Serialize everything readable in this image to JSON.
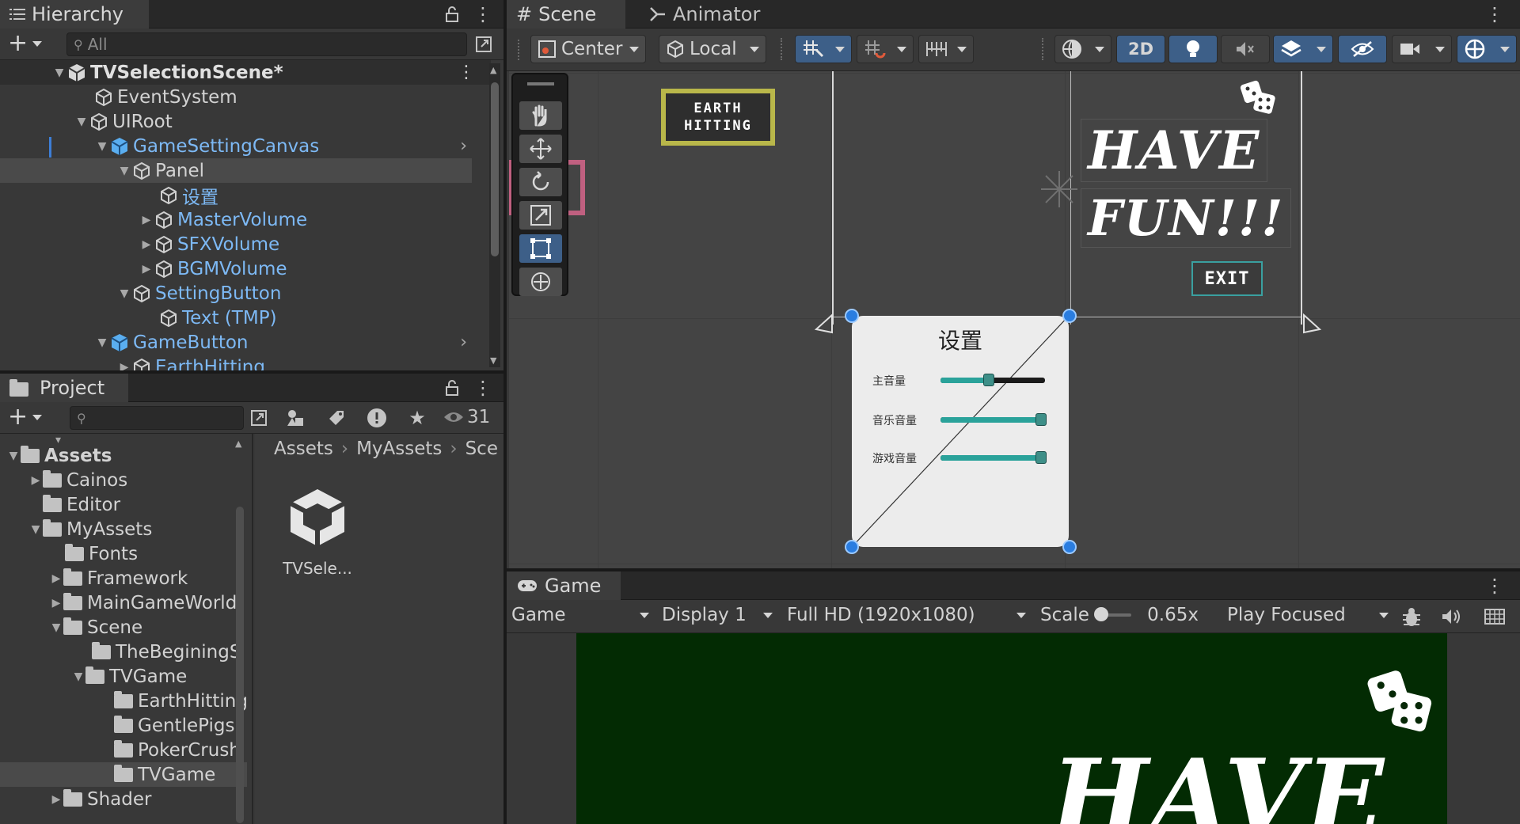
{
  "hierarchy": {
    "tab_label": "Hierarchy",
    "search_placeholder": "All",
    "items": [
      {
        "label": "TVSelectionScene*"
      },
      {
        "label": "EventSystem"
      },
      {
        "label": "UIRoot"
      },
      {
        "label": "GameSettingCanvas"
      },
      {
        "label": "Panel"
      },
      {
        "label": "设置"
      },
      {
        "label": "MasterVolume"
      },
      {
        "label": "SFXVolume"
      },
      {
        "label": "BGMVolume"
      },
      {
        "label": "SettingButton"
      },
      {
        "label": "Text (TMP)"
      },
      {
        "label": "GameButton"
      },
      {
        "label": "EarthHitting"
      }
    ]
  },
  "project": {
    "tab_label": "Project",
    "hidden_count": "31",
    "breadcrumb": [
      "Assets",
      "MyAssets",
      "Sce"
    ],
    "folders": [
      {
        "label": "Assets"
      },
      {
        "label": "Cainos"
      },
      {
        "label": "Editor"
      },
      {
        "label": "MyAssets"
      },
      {
        "label": "Fonts"
      },
      {
        "label": "Framework"
      },
      {
        "label": "MainGameWorld"
      },
      {
        "label": "Scene"
      },
      {
        "label": "TheBeginingS"
      },
      {
        "label": "TVGame"
      },
      {
        "label": "EarthHitting"
      },
      {
        "label": "GentlePigs"
      },
      {
        "label": "PokerCrush"
      },
      {
        "label": "TVGame"
      },
      {
        "label": "Shader"
      }
    ],
    "asset": {
      "label": "TVSele..."
    }
  },
  "scene": {
    "tab_scene": "Scene",
    "tab_animator": "Animator",
    "pivot": "Center",
    "space": "Local",
    "mode_2d": "2D",
    "canvas": {
      "earth_line1": "EARTH",
      "earth_line2": "HITTING",
      "have": "HAVE",
      "fun": "FUN!!!",
      "exit": "EXIT",
      "panel_title": "设置",
      "sliders": [
        {
          "label": "主音量",
          "value": 0.5
        },
        {
          "label": "音乐音量",
          "value": 1.0
        },
        {
          "label": "游戏音量",
          "value": 1.0
        }
      ]
    }
  },
  "game": {
    "tab_label": "Game",
    "mode": "Game",
    "display": "Display 1",
    "resolution": "Full HD (1920x1080)",
    "scale_label": "Scale",
    "scale_value": "0.65x",
    "play_mode": "Play Focused",
    "preview_text": "HAVE"
  },
  "colors": {
    "panel_bg": "#383838",
    "selection": "#4a4a4a",
    "prefab_blue": "#7db9f5",
    "active_tool": "#3d5f88",
    "game_bg": "#032b03"
  }
}
